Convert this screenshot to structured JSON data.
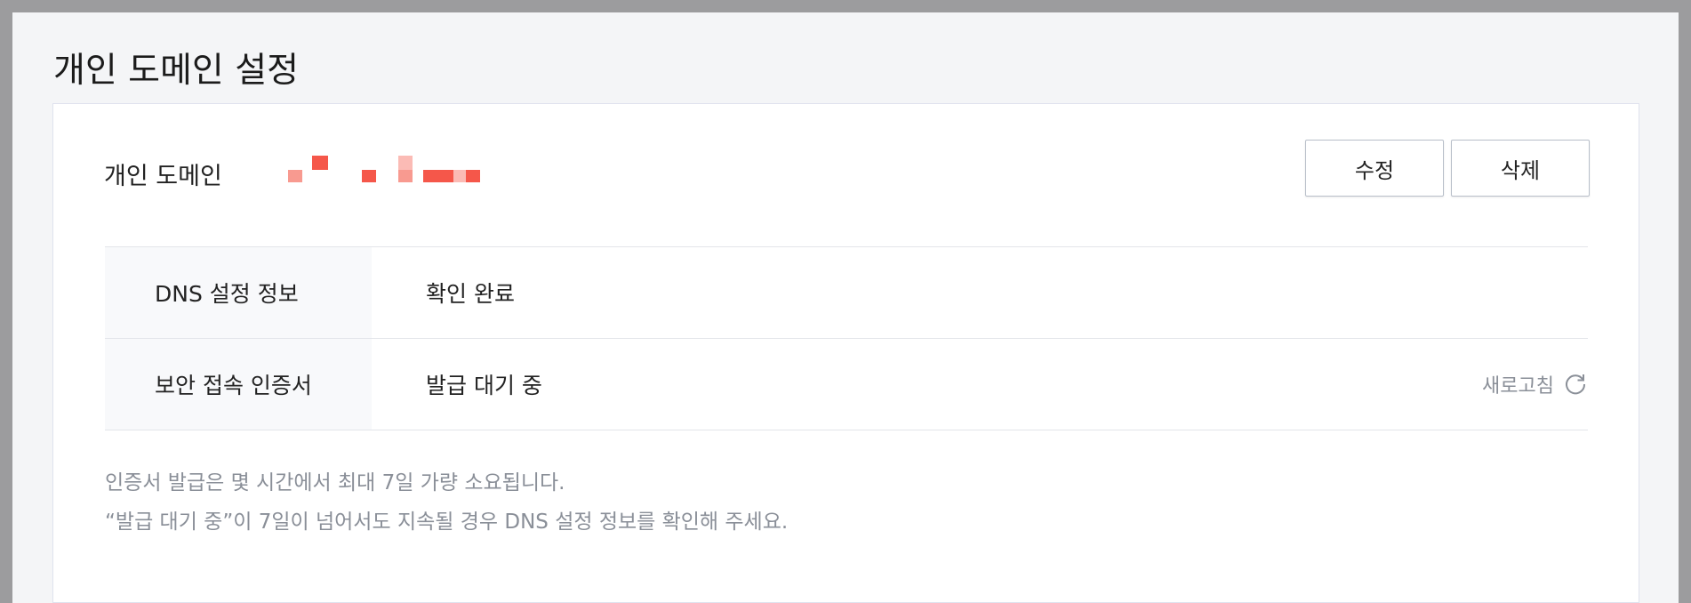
{
  "page": {
    "title": "개인 도메인 설정"
  },
  "domain": {
    "label": "개인 도메인",
    "value_redacted": true,
    "redaction_color": "#f5574a"
  },
  "actions": {
    "edit_label": "수정",
    "delete_label": "삭제"
  },
  "info": {
    "rows": [
      {
        "key": "DNS 설정 정보",
        "value": "확인 완료"
      },
      {
        "key": "보안 접속 인증서",
        "value": "발급 대기 중"
      }
    ],
    "refresh_label": "새로고침",
    "refresh_icon": "refresh-icon"
  },
  "notes": {
    "line1": "인증서 발급은 몇 시간에서 최대 7일 가량 소요됩니다.",
    "line2": "“발급 대기 중”이 7일이 넘어서도 지속될 경우 DNS 설정 정보를 확인해 주세요."
  },
  "colors": {
    "accent_redaction": "#f5574a",
    "muted_text": "#8a8f98",
    "border": "#e3e5ea"
  }
}
